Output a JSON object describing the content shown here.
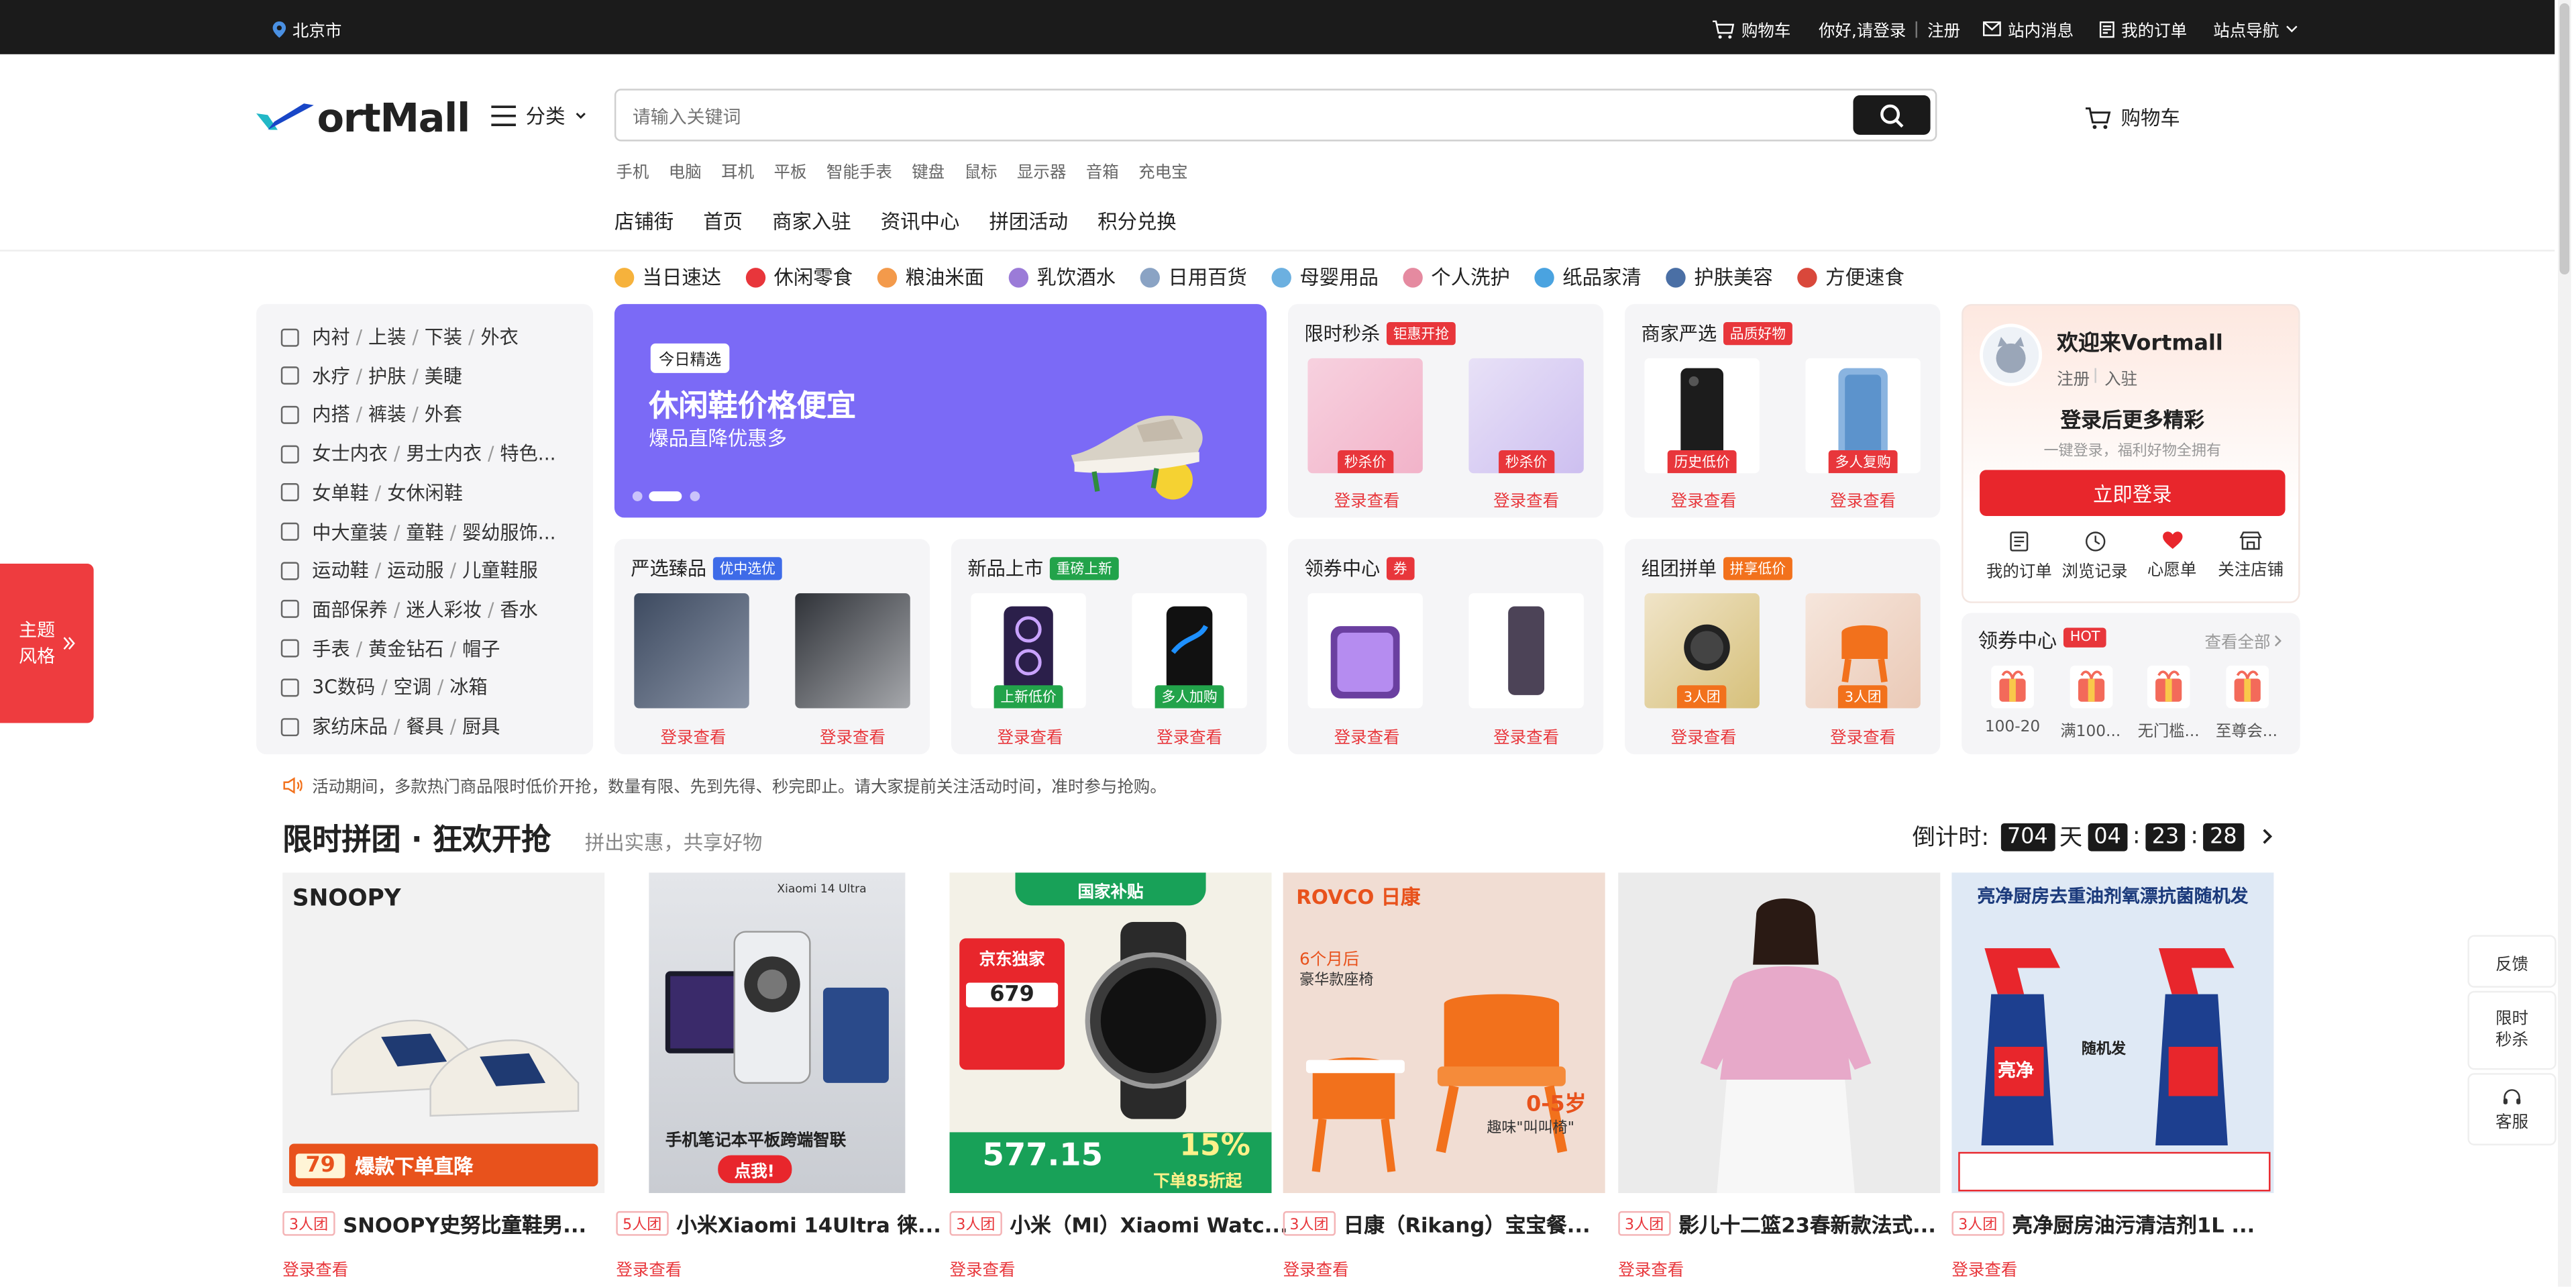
{
  "topbar": {
    "location": "北京市",
    "cart": "购物车",
    "greeting": "你好,请登录",
    "register": "注册",
    "messages": "站内消息",
    "orders": "我的订单",
    "site_nav": "站点导航"
  },
  "header": {
    "logo_text": "ortMall",
    "category_label": "分类",
    "search_placeholder": "请输入关键词",
    "cart_label": "购物车",
    "hot_words": [
      "手机",
      "电脑",
      "耳机",
      "平板",
      "智能手表",
      "键盘",
      "鼠标",
      "显示器",
      "音箱",
      "充电宝"
    ],
    "nav": [
      "店铺街",
      "首页",
      "商家入驻",
      "资讯中心",
      "拼团活动",
      "积分兑换"
    ]
  },
  "category_bar": [
    {
      "label": "当日速达",
      "color": "#f6b23c"
    },
    {
      "label": "休闲零食",
      "color": "#e8363b"
    },
    {
      "label": "粮油米面",
      "color": "#f39a4b"
    },
    {
      "label": "乳饮酒水",
      "color": "#9b7bd8"
    },
    {
      "label": "日用百货",
      "color": "#8aa3c4"
    },
    {
      "label": "母婴用品",
      "color": "#6cb0e0"
    },
    {
      "label": "个人洗护",
      "color": "#e58aa0"
    },
    {
      "label": "纸品家清",
      "color": "#4aa3e0"
    },
    {
      "label": "护肤美容",
      "color": "#4a6fa5"
    },
    {
      "label": "方便速食",
      "color": "#d9483b"
    }
  ],
  "left_menu": [
    [
      "内衬",
      "上装",
      "下装",
      "外衣"
    ],
    [
      "水疗",
      "护肤",
      "美睫"
    ],
    [
      "内搭",
      "裤装",
      "外套"
    ],
    [
      "女士内衣",
      "男士内衣",
      "特色..."
    ],
    [
      "女单鞋",
      "女休闲鞋"
    ],
    [
      "中大童装",
      "童鞋",
      "婴幼服饰..."
    ],
    [
      "运动鞋",
      "运动服",
      "儿童鞋服"
    ],
    [
      "面部保养",
      "迷人彩妆",
      "香水"
    ],
    [
      "手表",
      "黄金钻石",
      "帽子"
    ],
    [
      "3C数码",
      "空调",
      "冰箱"
    ],
    [
      "家纺床品",
      "餐具",
      "厨具"
    ]
  ],
  "banner": {
    "tag": "今日精选",
    "title": "休闲鞋价格便宜",
    "subtitle": "爆品直降优惠多"
  },
  "cards": {
    "flash": {
      "title": "限时秒杀",
      "badge": "钜惠开抢",
      "labels": [
        "秒杀价",
        "秒杀价"
      ],
      "link": "登录查看"
    },
    "merchant": {
      "title": "商家严选",
      "badge": "品质好物",
      "labels": [
        "历史低价",
        "多人复购"
      ],
      "link": "登录查看"
    },
    "strict": {
      "title": "严选臻品",
      "badge": "优中选优",
      "link": "登录查看"
    },
    "new": {
      "title": "新品上市",
      "badge": "重磅上新",
      "labels": [
        "上新低价",
        "多人加购"
      ],
      "link": "登录查看"
    },
    "coupon": {
      "title": "领券中心",
      "badge": "券",
      "link": "登录查看"
    },
    "group": {
      "title": "组团拼单",
      "badge": "拼享低价",
      "labels": [
        "3人团",
        "3人团"
      ],
      "link": "登录查看"
    }
  },
  "profile": {
    "welcome": "欢迎来Vortmall",
    "register": "注册",
    "join": "入驻",
    "headline": "登录后更多精彩",
    "sub": "一键登录，福利好物全拥有",
    "login_btn": "立即登录",
    "shortcuts": [
      "我的订单",
      "浏览记录",
      "心愿单",
      "关注店铺"
    ]
  },
  "coupon_center": {
    "title": "领券中心",
    "hot": "HOT",
    "view_all": "查看全部",
    "items": [
      "100-20",
      "满100...",
      "无门槛...",
      "至尊会..."
    ]
  },
  "notice": "活动期间，多款热门商品限时低价开抢，数量有限、先到先得、秒完即止。请大家提前关注活动时间，准时参与抢购。",
  "group_section": {
    "title": "限时拼团 · 狂欢开抢",
    "subtitle": "拼出实惠，共享好物",
    "countdown_label": "倒计时:",
    "days": "704",
    "day_unit": "天",
    "hours": "04",
    "minutes": "23",
    "seconds": "28",
    "products": [
      {
        "tag": "3人团",
        "name": "SNOOPY史努比童鞋男...",
        "link": "登录查看"
      },
      {
        "tag": "5人团",
        "name": "小米Xiaomi 14Ultra 徕...",
        "link": "登录查看"
      },
      {
        "tag": "3人团",
        "name": "小米（MI）Xiaomi Watc...",
        "link": "登录查看"
      },
      {
        "tag": "3人团",
        "name": "日康（Rikang）宝宝餐...",
        "link": "登录查看"
      },
      {
        "tag": "3人团",
        "name": "影儿十二篮23春新款法式...",
        "link": "登录查看"
      },
      {
        "tag": "3人团",
        "name": "亮净厨房油污清洁剂1L ...",
        "link": "登录查看"
      }
    ],
    "img_text": {
      "snoopy": "SNOOPY",
      "snoopy_price": "79",
      "snoopy_slogan": "爆款下单直降",
      "xiaomi_brand": "Xiaomi 14 Ultra",
      "xiaomi_caption": "手机笔记本平板跨端智联",
      "xiaomi_btn": "点我!",
      "watch_top": "国家补贴",
      "watch_excl": "京东独家",
      "watch_price": "679",
      "watch_big": "577.15",
      "watch_pct": "15%",
      "watch_down": "下单85折起",
      "rikang_brand": "ROVCO 日康",
      "rikang_month": "6个月后",
      "rikang_sub": "豪华款座椅",
      "rikang_age": "0-5岁",
      "rikang_fun": "趣味\"叫叫椅\"",
      "clean_title": "亮净厨房去重油剂氧漂抗菌随机发",
      "clean_random": "随机发",
      "clean_brand": "亮净"
    }
  },
  "side": {
    "theme_label1": "主题",
    "theme_label2": "风格",
    "feedback": "反馈",
    "flash_sale1": "限时",
    "flash_sale2": "秒杀",
    "service": "客服"
  }
}
